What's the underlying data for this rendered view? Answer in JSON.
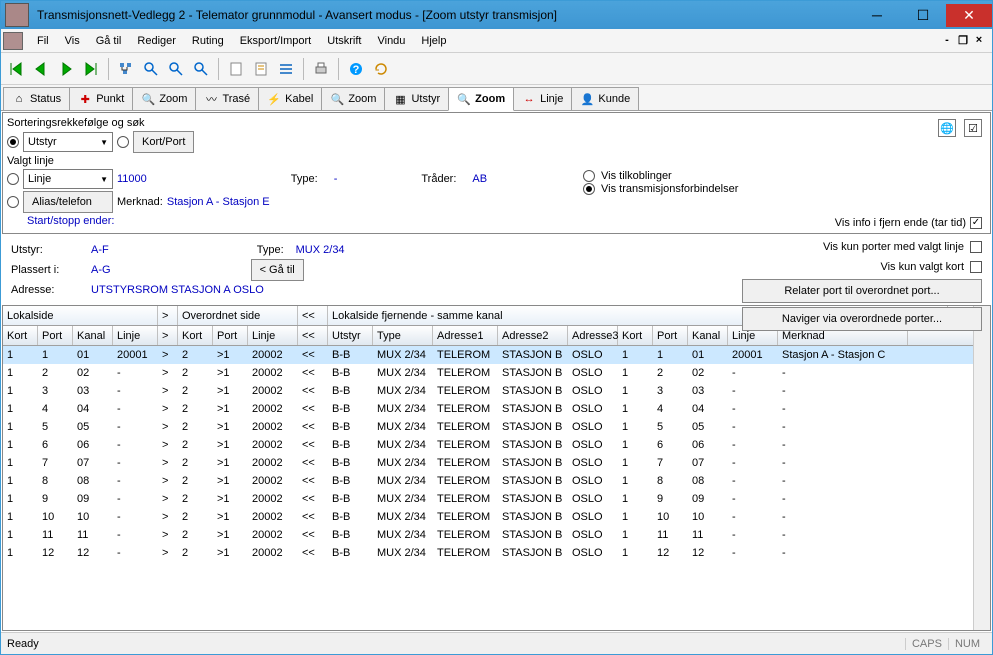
{
  "titlebar": {
    "title": "Transmisjonsnett-Vedlegg 2 - Telemator grunnmodul - Avansert modus - [Zoom utstyr transmisjon]"
  },
  "menu": {
    "items": [
      "Fil",
      "Vis",
      "Gå til",
      "Rediger",
      "Ruting",
      "Eksport/Import",
      "Utskrift",
      "Vindu",
      "Hjelp"
    ]
  },
  "tabs": {
    "items": [
      {
        "label": "Status"
      },
      {
        "label": "Punkt"
      },
      {
        "label": "Zoom"
      },
      {
        "label": "Trasé"
      },
      {
        "label": "Kabel"
      },
      {
        "label": "Zoom"
      },
      {
        "label": "Utstyr"
      },
      {
        "label": "Zoom",
        "active": true
      },
      {
        "label": "Linje"
      },
      {
        "label": "Kunde"
      }
    ]
  },
  "sort": {
    "heading": "Sorteringsrekkefølge og søk",
    "utstyr_label": "Utstyr",
    "kortport_btn": "Kort/Port"
  },
  "linje": {
    "heading": "Valgt linje",
    "linje_label": "Linje",
    "linje_value": "11000",
    "type_label": "Type:",
    "type_value": "-",
    "trader_label": "Tråder:",
    "trader_value": "AB",
    "alias_label": "Alias/telefon",
    "merknad_label": "Merknad:",
    "merknad_value": "Stasjon A - Stasjon E",
    "startstopp_label": "Start/stopp ender:"
  },
  "viewopts": {
    "opt1": "Vis tilkoblinger",
    "opt2": "Vis transmisjonsforbindelser",
    "bottom": "Vis info i fjern ende (tar tid)"
  },
  "mid": {
    "utstyr_label": "Utstyr:",
    "utstyr_value": "A-F",
    "type_label": "Type:",
    "type_value": "MUX 2/34",
    "plassert_label": "Plassert i:",
    "plassert_value": "A-G",
    "adresse_label": "Adresse:",
    "adresse_value": "UTSTYRSROM STASJON A OSLO",
    "gatil_btn": "< Gå til",
    "right_opt1": "Vis kun porter med valgt linje",
    "right_opt2": "Vis kun valgt kort",
    "btn1": "Relater port til overordnet port...",
    "btn2": "Naviger via overordnede porter..."
  },
  "grid": {
    "groups": {
      "lokal": "Lokalside",
      "gt": ">",
      "over": "Overordnet side",
      "lt": "<<",
      "fjern": "Lokalside fjernende - samme kanal"
    },
    "cols": [
      "Kort",
      "Port",
      "Kanal",
      "Linje",
      ">",
      "Kort",
      "Port",
      "Linje",
      "<<",
      "Utstyr",
      "Type",
      "Adresse1",
      "Adresse2",
      "Adresse3",
      "Kort",
      "Port",
      "Kanal",
      "Linje",
      "Merknad"
    ],
    "rows": [
      [
        "1",
        "1",
        "01",
        "20001",
        ">",
        "2",
        ">1",
        "20002",
        "<<",
        "B-B",
        "MUX 2/34",
        "TELEROM",
        "STASJON B",
        "OSLO",
        "1",
        "1",
        "01",
        "20001",
        "Stasjon A - Stasjon C"
      ],
      [
        "1",
        "2",
        "02",
        "-",
        ">",
        "2",
        ">1",
        "20002",
        "<<",
        "B-B",
        "MUX 2/34",
        "TELEROM",
        "STASJON B",
        "OSLO",
        "1",
        "2",
        "02",
        "-",
        "-"
      ],
      [
        "1",
        "3",
        "03",
        "-",
        ">",
        "2",
        ">1",
        "20002",
        "<<",
        "B-B",
        "MUX 2/34",
        "TELEROM",
        "STASJON B",
        "OSLO",
        "1",
        "3",
        "03",
        "-",
        "-"
      ],
      [
        "1",
        "4",
        "04",
        "-",
        ">",
        "2",
        ">1",
        "20002",
        "<<",
        "B-B",
        "MUX 2/34",
        "TELEROM",
        "STASJON B",
        "OSLO",
        "1",
        "4",
        "04",
        "-",
        "-"
      ],
      [
        "1",
        "5",
        "05",
        "-",
        ">",
        "2",
        ">1",
        "20002",
        "<<",
        "B-B",
        "MUX 2/34",
        "TELEROM",
        "STASJON B",
        "OSLO",
        "1",
        "5",
        "05",
        "-",
        "-"
      ],
      [
        "1",
        "6",
        "06",
        "-",
        ">",
        "2",
        ">1",
        "20002",
        "<<",
        "B-B",
        "MUX 2/34",
        "TELEROM",
        "STASJON B",
        "OSLO",
        "1",
        "6",
        "06",
        "-",
        "-"
      ],
      [
        "1",
        "7",
        "07",
        "-",
        ">",
        "2",
        ">1",
        "20002",
        "<<",
        "B-B",
        "MUX 2/34",
        "TELEROM",
        "STASJON B",
        "OSLO",
        "1",
        "7",
        "07",
        "-",
        "-"
      ],
      [
        "1",
        "8",
        "08",
        "-",
        ">",
        "2",
        ">1",
        "20002",
        "<<",
        "B-B",
        "MUX 2/34",
        "TELEROM",
        "STASJON B",
        "OSLO",
        "1",
        "8",
        "08",
        "-",
        "-"
      ],
      [
        "1",
        "9",
        "09",
        "-",
        ">",
        "2",
        ">1",
        "20002",
        "<<",
        "B-B",
        "MUX 2/34",
        "TELEROM",
        "STASJON B",
        "OSLO",
        "1",
        "9",
        "09",
        "-",
        "-"
      ],
      [
        "1",
        "10",
        "10",
        "-",
        ">",
        "2",
        ">1",
        "20002",
        "<<",
        "B-B",
        "MUX 2/34",
        "TELEROM",
        "STASJON B",
        "OSLO",
        "1",
        "10",
        "10",
        "-",
        "-"
      ],
      [
        "1",
        "11",
        "11",
        "-",
        ">",
        "2",
        ">1",
        "20002",
        "<<",
        "B-B",
        "MUX 2/34",
        "TELEROM",
        "STASJON B",
        "OSLO",
        "1",
        "11",
        "11",
        "-",
        "-"
      ],
      [
        "1",
        "12",
        "12",
        "-",
        ">",
        "2",
        ">1",
        "20002",
        "<<",
        "B-B",
        "MUX 2/34",
        "TELEROM",
        "STASJON B",
        "OSLO",
        "1",
        "12",
        "12",
        "-",
        "-"
      ]
    ]
  },
  "status": {
    "ready": "Ready",
    "caps": "CAPS",
    "num": "NUM"
  }
}
